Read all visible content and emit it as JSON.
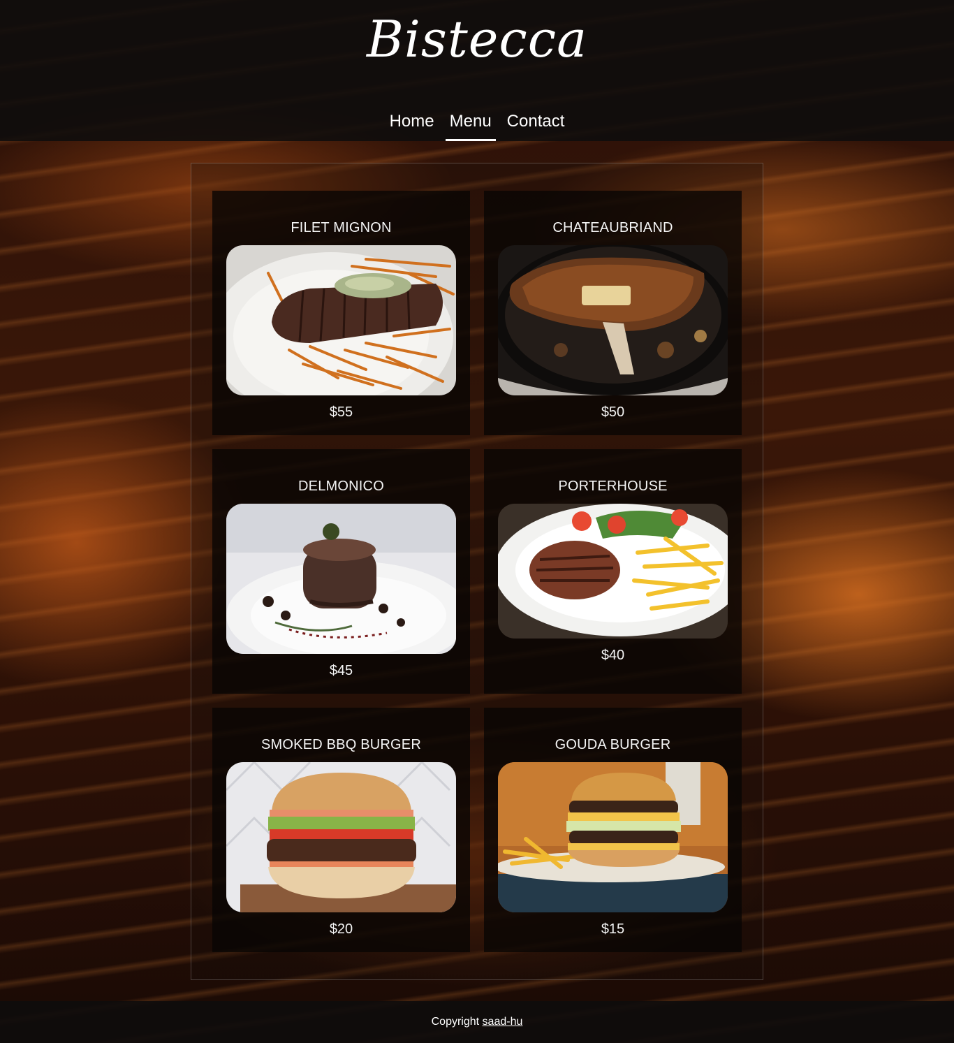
{
  "header": {
    "brand": "Bistecca",
    "nav": [
      {
        "label": "Home",
        "active": false
      },
      {
        "label": "Menu",
        "active": true
      },
      {
        "label": "Contact",
        "active": false
      }
    ]
  },
  "menu": {
    "items": [
      {
        "name": "FILET MIGNON",
        "price": "$55",
        "photo": "steak-with-fries-photo"
      },
      {
        "name": "CHATEAUBRIAND",
        "price": "$50",
        "photo": "steak-in-skillet-photo"
      },
      {
        "name": "DELMONICO",
        "price": "$45",
        "photo": "stacked-steak-plate-photo"
      },
      {
        "name": "PORTERHOUSE",
        "price": "$40",
        "photo": "grilled-steak-with-fries-photo"
      },
      {
        "name": "SMOKED BBQ BURGER",
        "price": "$20",
        "photo": "bbq-burger-photo"
      },
      {
        "name": "GOUDA BURGER",
        "price": "$15",
        "photo": "double-burger-photo"
      }
    ]
  },
  "footer": {
    "prefix": "Copyright",
    "link_label": "saad-hu"
  }
}
